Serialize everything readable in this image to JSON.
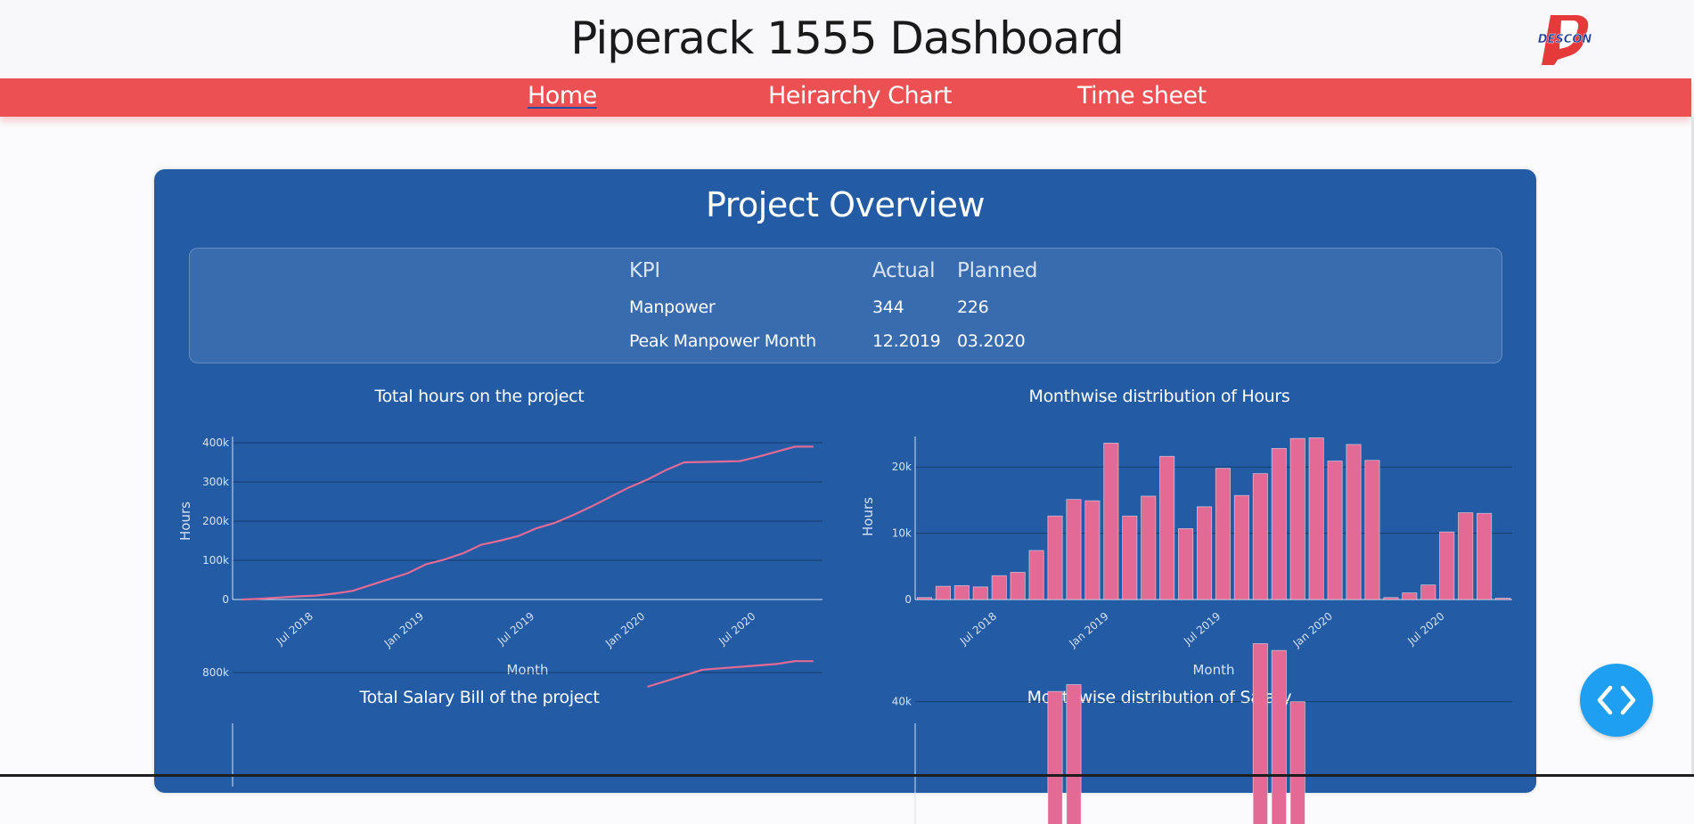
{
  "header": {
    "title": "Piperack 1555 Dashboard",
    "logo_text": "DESCON",
    "logo_color": "#e63a3a"
  },
  "nav": {
    "items": [
      "Home",
      "Heirarchy Chart",
      "Time sheet"
    ],
    "active": "Home",
    "bar_color": "#ec5052"
  },
  "overview": {
    "title": "Project Overview",
    "kpi": {
      "headers": [
        "KPI",
        "Actual",
        "Planned"
      ],
      "rows": [
        [
          "Manpower",
          "344",
          "226"
        ],
        [
          "Peak Manpower Month",
          "12.2019",
          "03.2020"
        ]
      ]
    }
  },
  "colors": {
    "panel": "#235ca5",
    "series": "#e26a94",
    "fab": "#1e9ff2"
  },
  "icons": {
    "fab": "chevron-left-right-icon"
  },
  "chart_data": [
    {
      "id": "total-hours",
      "type": "line",
      "title": "Total hours on the project",
      "xlabel": "Month",
      "ylabel": "Hours",
      "ylim": [
        0,
        400000
      ],
      "yticks": [
        0,
        100000,
        200000,
        300000,
        400000
      ],
      "ytick_labels": [
        "0",
        "100k",
        "200k",
        "300k",
        "400k"
      ],
      "xticks": [
        "Jul 2018",
        "Jan 2019",
        "Jul 2019",
        "Jan 2020",
        "Jul 2020"
      ],
      "grid": true,
      "x": [
        "2018-03",
        "2018-04",
        "2018-05",
        "2018-06",
        "2018-07",
        "2018-08",
        "2018-09",
        "2018-10",
        "2018-11",
        "2018-12",
        "2019-01",
        "2019-02",
        "2019-03",
        "2019-04",
        "2019-05",
        "2019-06",
        "2019-07",
        "2019-08",
        "2019-09",
        "2019-10",
        "2019-11",
        "2019-12",
        "2020-01",
        "2020-02",
        "2020-03",
        "2020-04",
        "2020-05",
        "2020-06",
        "2020-07",
        "2020-08",
        "2020-09",
        "2020-10"
      ],
      "y": [
        0,
        2000,
        5000,
        8000,
        10000,
        15000,
        22000,
        37000,
        52000,
        67000,
        90000,
        102000,
        118000,
        140000,
        150000,
        162000,
        182000,
        196000,
        216000,
        238000,
        262000,
        286000,
        306000,
        330000,
        350000,
        351000,
        352000,
        353000,
        364000,
        377000,
        390000,
        390000
      ]
    },
    {
      "id": "monthwise-hours",
      "type": "bar",
      "title": "Monthwise distribution of Hours",
      "xlabel": "Month",
      "ylabel": "Hours",
      "ylim": [
        0,
        25000
      ],
      "yticks": [
        0,
        10000,
        20000
      ],
      "ytick_labels": [
        "0",
        "10k",
        "20k"
      ],
      "xticks": [
        "Jul 2018",
        "Jan 2019",
        "Jul 2019",
        "Jan 2020",
        "Jul 2020"
      ],
      "grid": true,
      "x": [
        "2018-03",
        "2018-04",
        "2018-05",
        "2018-06",
        "2018-07",
        "2018-08",
        "2018-09",
        "2018-10",
        "2018-11",
        "2018-12",
        "2019-01",
        "2019-02",
        "2019-03",
        "2019-04",
        "2019-05",
        "2019-06",
        "2019-07",
        "2019-08",
        "2019-09",
        "2019-10",
        "2019-11",
        "2019-12",
        "2020-01",
        "2020-02",
        "2020-03",
        "2020-04",
        "2020-05",
        "2020-06",
        "2020-07",
        "2020-08",
        "2020-09",
        "2020-10"
      ],
      "values": [
        300,
        2000,
        2100,
        1900,
        3600,
        4100,
        7400,
        12600,
        15100,
        14900,
        23600,
        12600,
        15600,
        21600,
        10700,
        14000,
        19800,
        15700,
        19000,
        22800,
        24300,
        24400,
        20900,
        23400,
        21000,
        300,
        1000,
        2200,
        10200,
        13100,
        13000,
        200
      ]
    },
    {
      "id": "total-salary",
      "type": "line",
      "title": "Total Salary Bill of the project",
      "yticks": [
        800000
      ],
      "ytick_labels": [
        "800k"
      ],
      "grid": true,
      "x": [
        "2020-01",
        "2020-02",
        "2020-03",
        "2020-04",
        "2020-05",
        "2020-06",
        "2020-07",
        "2020-08",
        "2020-09",
        "2020-10"
      ],
      "y": [
        700000,
        740000,
        780000,
        820000,
        830000,
        840000,
        850000,
        860000,
        880000,
        880000
      ]
    },
    {
      "id": "monthwise-salary",
      "type": "bar",
      "title": "Monthwise distribution of Salary",
      "yticks": [
        40000
      ],
      "ytick_labels": [
        "40k"
      ],
      "grid": true,
      "x": [
        "2018-10",
        "2018-11",
        "2019-09",
        "2019-10",
        "2019-11"
      ],
      "values": [
        43000,
        45000,
        57000,
        55000,
        40000
      ]
    }
  ]
}
